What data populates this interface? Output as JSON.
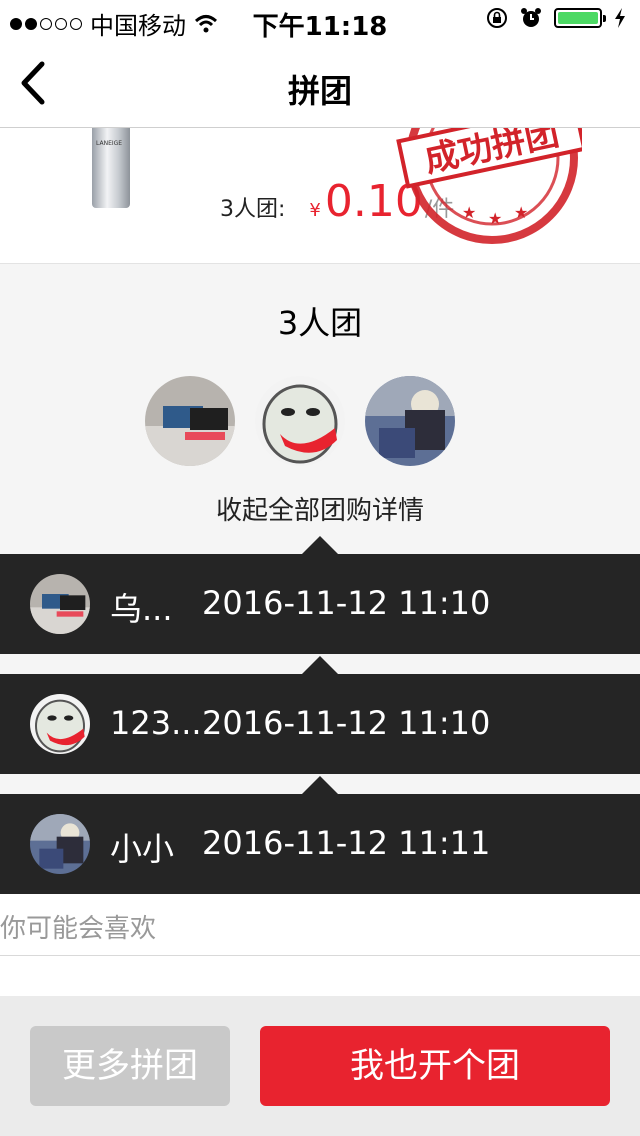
{
  "status_bar": {
    "carrier": "中国移动",
    "time": "下午11:18",
    "battery_color": "#4cd964"
  },
  "navbar": {
    "title": "拼团",
    "back_icon": "chevron-left-icon"
  },
  "product": {
    "image_icon": "skincare-bottle",
    "bottle_label": "LANEIGE",
    "price_label": "3人团:",
    "currency": "¥",
    "price": "0.10",
    "unit": "/件",
    "stamp_text": "成功拼团",
    "accent_color": "#e8232f"
  },
  "group": {
    "title": "3人团",
    "collapse_label": "收起全部团购详情",
    "members": [
      {
        "name": "乌...",
        "time": "2016-11-12 11:10",
        "avatar": "keyboard-photo"
      },
      {
        "name": "123...",
        "time": "2016-11-12 11:10",
        "avatar": "meme-face"
      },
      {
        "name": "小小",
        "time": "2016-11-12 11:11",
        "avatar": "person-photo"
      }
    ]
  },
  "recommend": {
    "label": "你可能会喜欢"
  },
  "footer": {
    "more_label": "更多拼团",
    "open_label": "我也开个团"
  }
}
